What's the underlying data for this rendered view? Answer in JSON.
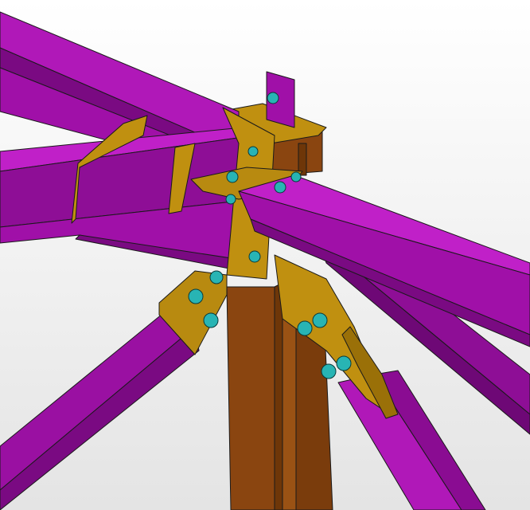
{
  "scene": {
    "description_label": "",
    "colors": {
      "beam": "#a010a8",
      "beam_dark": "#7a0a82",
      "beam_light": "#c020c8",
      "column": "#8a4510",
      "column_dark": "#6e3608",
      "plate": "#c09010",
      "plate_dark": "#9a7008",
      "bolt": "#28b4b4"
    }
  }
}
